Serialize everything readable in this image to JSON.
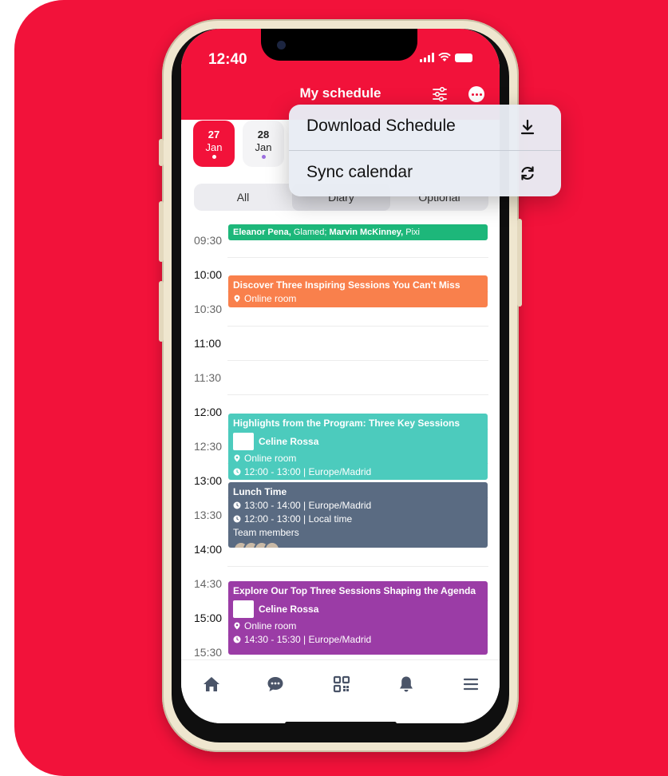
{
  "status_bar": {
    "time": "12:40"
  },
  "header": {
    "title": "My schedule"
  },
  "dates": [
    {
      "day": "27",
      "month": "Jan"
    },
    {
      "day": "28",
      "month": "Jan"
    }
  ],
  "segments": [
    "All",
    "Diary",
    "Optional"
  ],
  "timeline": [
    "09:30",
    "10:00",
    "10:30",
    "11:00",
    "11:30",
    "12:00",
    "12:30",
    "13:00",
    "13:30",
    "14:00",
    "14:30",
    "15:00",
    "15:30"
  ],
  "events": [
    {
      "speaker1": "Eleanor Pena,",
      "company1": " Glamed;",
      "speaker2": " Marvin McKinney,",
      "company2": " Pixi",
      "color": "#1db77a"
    },
    {
      "title": "Discover Three Inspiring Sessions You Can't Miss",
      "location": "Online room",
      "color": "#f9804c"
    },
    {
      "title": "Highlights from the Program: Three Key Sessions",
      "speaker": "Celine Rossa",
      "location": "Online room",
      "time": "12:00 - 13:00 | Europe/Madrid",
      "color": "#4ccbbd"
    },
    {
      "title": "Lunch Time",
      "time": "13:00 - 14:00 | Europe/Madrid",
      "local_time": "12:00 - 13:00 | Local time",
      "members_label": "Team members",
      "color": "#5a6b82"
    },
    {
      "title": "Explore Our Top Three Sessions Shaping the Agenda",
      "speaker": "Celine Rossa",
      "location": "Online room",
      "time": "14:30 - 15:30 | Europe/Madrid",
      "color": "#9b3ca6"
    }
  ],
  "menu": {
    "items": [
      {
        "label": "Download Schedule",
        "icon": "download-icon"
      },
      {
        "label": "Sync calendar",
        "icon": "sync-icon"
      }
    ]
  },
  "tabbar": [
    "home-icon",
    "chat-icon",
    "qr-code-icon",
    "bell-icon",
    "menu-icon"
  ],
  "colors": {
    "brand": "#f2123a"
  }
}
